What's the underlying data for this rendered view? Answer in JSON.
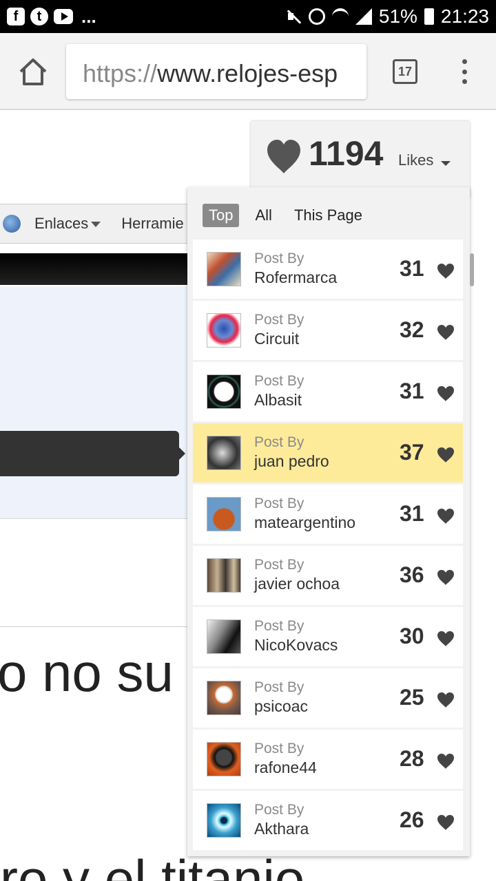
{
  "status_bar": {
    "battery": "51%",
    "time": "21:23",
    "more": "...",
    "icons": [
      "facebook-icon",
      "tumblr-icon",
      "youtube-icon",
      "mute-icon",
      "alarm-icon",
      "wifi-icon",
      "signal-icon",
      "battery-icon"
    ]
  },
  "browser": {
    "url_scheme": "https://",
    "url_host": "www.relojes-esp",
    "tab_count": "17"
  },
  "page": {
    "nav_links": [
      "Enlaces",
      "Herramie"
    ],
    "headline_fragment": "o no su",
    "headline_fragment_2": "ro y el titanio"
  },
  "likes": {
    "count": "1194",
    "label": "Likes",
    "tabs": [
      "Top",
      "All",
      "This Page"
    ],
    "active_tab": "Top",
    "post_by_label": "Post By",
    "highlight_color": "#fdeb9a",
    "posts": [
      {
        "author": "Rofermarca",
        "count": "31"
      },
      {
        "author": "Circuit",
        "count": "32"
      },
      {
        "author": "Albasit",
        "count": "31"
      },
      {
        "author": "juan pedro",
        "count": "37"
      },
      {
        "author": "mateargentino",
        "count": "31"
      },
      {
        "author": "javier ochoa",
        "count": "36"
      },
      {
        "author": "NicoKovacs",
        "count": "30"
      },
      {
        "author": "psicoac",
        "count": "25"
      },
      {
        "author": "rafone44",
        "count": "28"
      },
      {
        "author": "Akthara",
        "count": "26"
      }
    ]
  }
}
